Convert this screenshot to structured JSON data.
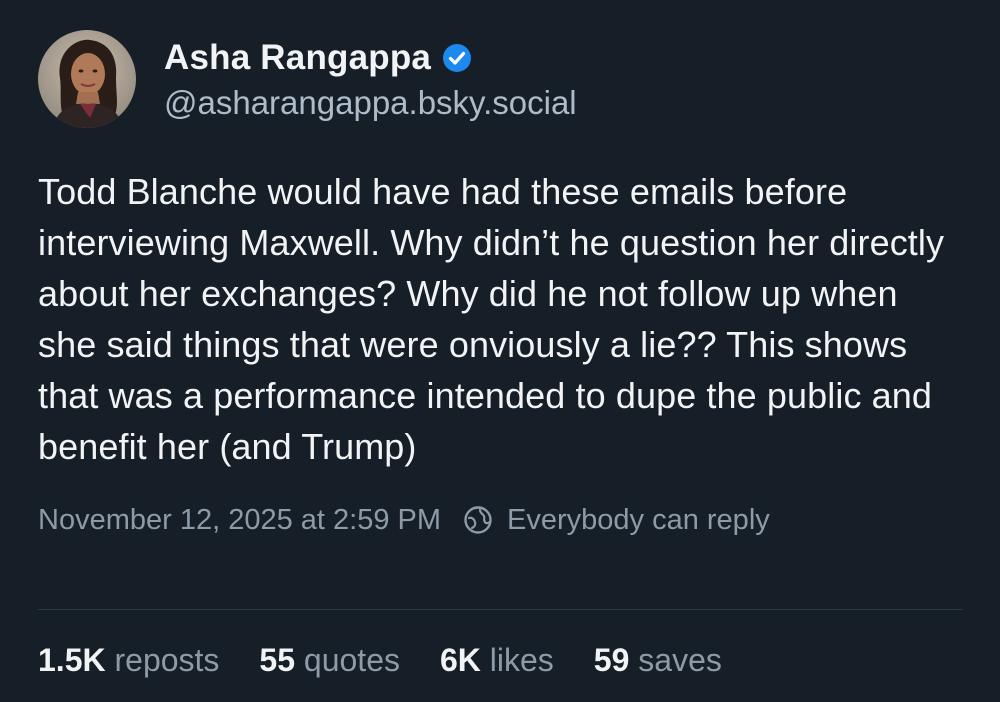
{
  "author": {
    "display_name": "Asha Rangappa",
    "handle": "@asharangappa.bsky.social",
    "verified": true,
    "verified_icon": "verified-badge-icon",
    "verified_color": "#1d88ee"
  },
  "post": {
    "text": "Todd Blanche would have had these emails before interviewing Maxwell. Why didn’t he question her directly about her exchanges? Why did he not follow up when she said things that were onviously a lie?? This shows that was a performance intended to dupe the public and benefit her (and Trump)",
    "timestamp": "November 12, 2025 at 2:59 PM",
    "reply_setting": "Everybody can reply",
    "reply_icon": "globe-icon"
  },
  "stats": [
    {
      "count": "1.5K",
      "label": "reposts"
    },
    {
      "count": "55",
      "label": "quotes"
    },
    {
      "count": "6K",
      "label": "likes"
    },
    {
      "count": "59",
      "label": "saves"
    }
  ],
  "colors": {
    "background": "#161e27",
    "text_primary": "#f1f3f5",
    "text_secondary": "#8d9aa8",
    "handle": "#aebbc9",
    "divider": "#2c3744"
  }
}
